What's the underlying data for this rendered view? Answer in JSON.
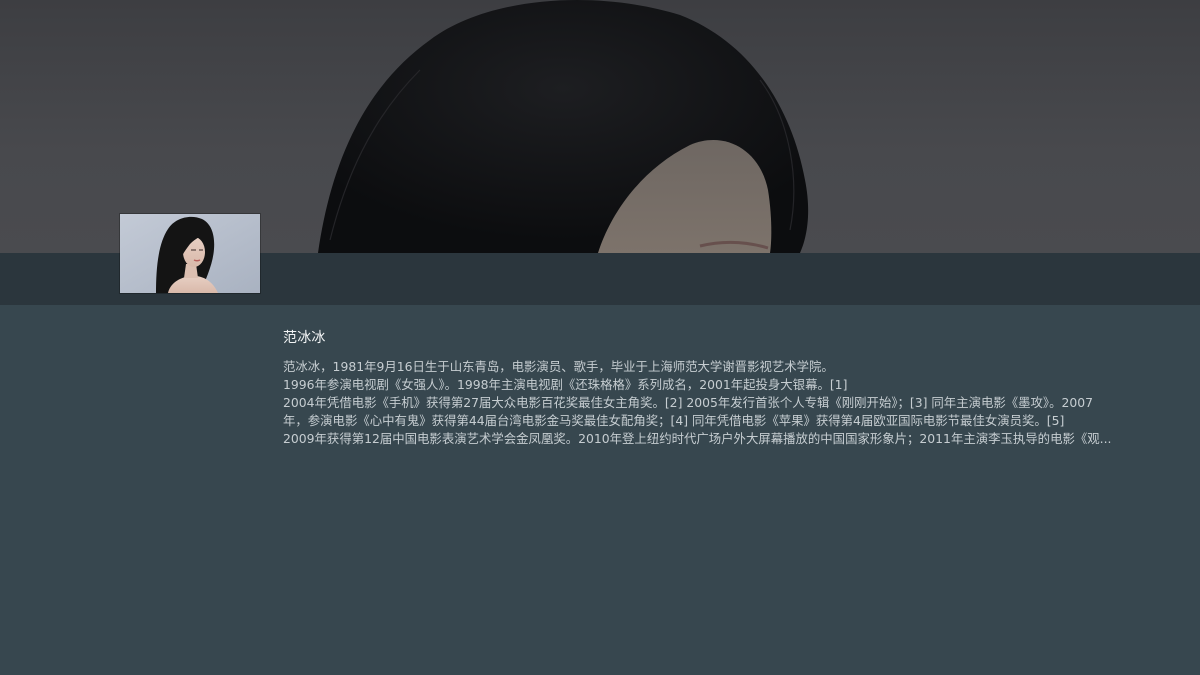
{
  "item": {
    "title": "范冰冰",
    "description_lines": [
      "范冰冰，1981年9月16日生于山东青岛，电影演员、歌手，毕业于上海师范大学谢晋影视艺术学院。",
      "1996年参演电视剧《女强人》。1998年主演电视剧《还珠格格》系列成名，2001年起投身大银幕。[1]",
      "2004年凭借电影《手机》获得第27届大众电影百花奖最佳女主角奖。[2]  2005年发行首张个人专辑《刚刚开始》；[3]  同年主演电影《墨攻》。2007",
      "年，参演电影《心中有鬼》获得第44届台湾电影金马奖最佳女配角奖；[4]  同年凭借电影《苹果》获得第4届欧亚国际电影节最佳女演员奖。[5]",
      "2009年获得第12届中国电影表演艺术学会金凤凰奖。2010年登上纽约时代广场户外大屏幕播放的中国国家形象片；2011年主演李玉执导的电影《观..."
    ]
  },
  "colors": {
    "backdrop_bg": "#46474b",
    "band_bg": "#2b363d",
    "panel_bg": "#37474f",
    "title_text": "#f1f3f4",
    "body_text": "#c6cdd1"
  },
  "icons": {
    "backdrop": "portrait-backdrop-image",
    "thumbnail": "portrait-thumbnail-image"
  }
}
